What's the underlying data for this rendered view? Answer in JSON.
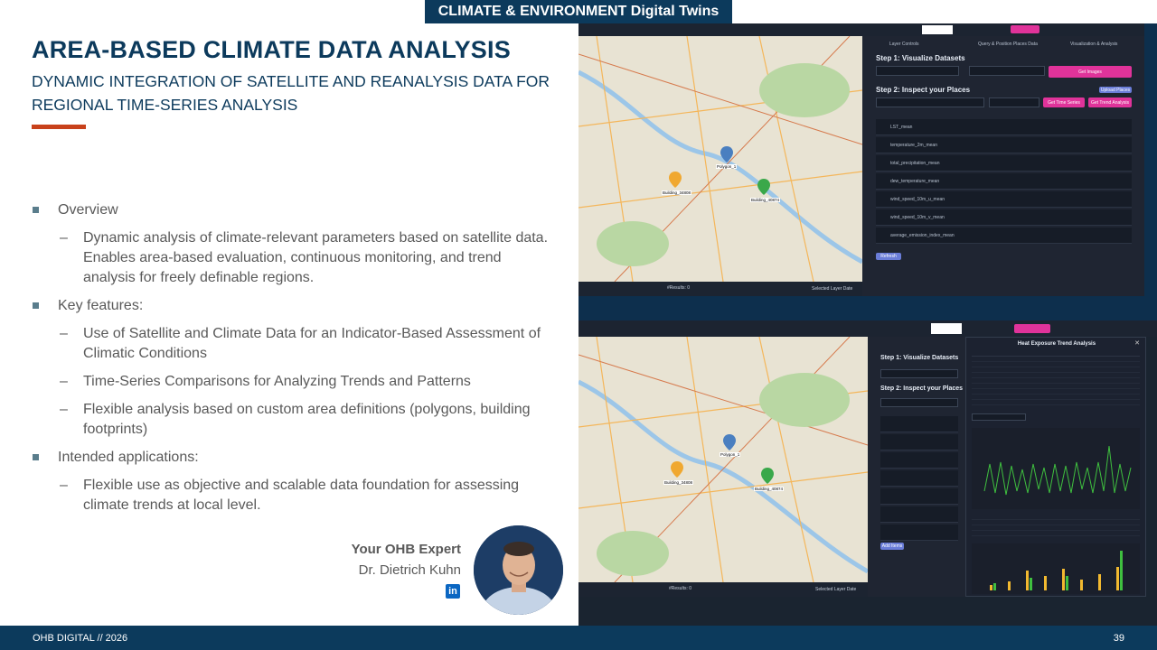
{
  "header": {
    "tag": "CLIMATE & ENVIRONMENT Digital Twins"
  },
  "slide": {
    "title": "AREA-BASED CLIMATE DATA ANALYSIS",
    "subtitle": "DYNAMIC INTEGRATION OF SATELLITE AND REANALYSIS DATA FOR REGIONAL TIME-SERIES ANALYSIS",
    "bullets": [
      {
        "label": "Overview",
        "subs": [
          "Dynamic analysis of climate-relevant parameters based on satellite data. Enables area-based evaluation, continuous monitoring, and trend analysis for freely definable regions."
        ]
      },
      {
        "label": "Key features:",
        "subs": [
          "Use of Satellite and Climate Data for an Indicator-Based Assessment of Climatic Conditions",
          "Time-Series Comparisons for Analyzing Trends and Patterns",
          "Flexible analysis based on custom area definitions (polygons, building footprints)"
        ]
      },
      {
        "label": "Intended applications:",
        "subs": [
          "Flexible use as objective and scalable data foundation for assessing climate trends at local level."
        ]
      }
    ],
    "expert": {
      "heading": "Your OHB Expert",
      "name": "Dr. Dietrich Kuhn",
      "linkedin": "in"
    }
  },
  "app": {
    "step1": "Step 1: Visualize Datasets",
    "step2": "Step 2: Inspect your Places",
    "tabs": [
      "Layer Controls",
      "Query & Position Places Data",
      "Visualization & Analysis"
    ],
    "buttons": {
      "get_images": "Get Images",
      "get_time_series": "Get Time Series",
      "get_trend": "Get Trend Analysis",
      "upload_places": "Upload Places",
      "refresh": "Refresh",
      "add_item": "Add Items"
    },
    "places": [
      "Building_34808",
      "Polygon_1",
      "Building_40874"
    ],
    "rows": [
      "LST_mean",
      "temperature_2m_mean",
      "total_precipitation_mean",
      "dew_temperature_mean",
      "wind_speed_10m_u_mean",
      "wind_speed_10m_v_mean",
      "average_emission_index_mean"
    ],
    "trend_title": "Heat Exposure Trend Analysis",
    "results": "#Results: 0",
    "layer_date": "Selected Layer Date"
  },
  "footer": {
    "left": "OHB DIGITAL // 2026",
    "page": "39"
  },
  "colors": {
    "navy": "#0c3a5c",
    "accent": "#c8411b",
    "pink": "#e0339a",
    "chart_line": "#3fbf3f"
  }
}
